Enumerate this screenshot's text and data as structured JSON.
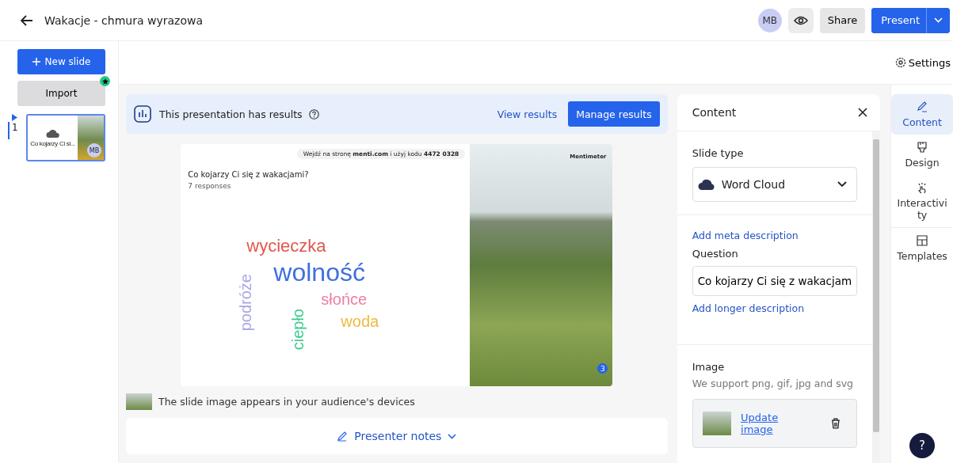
{
  "header": {
    "title": "Wakacje - chmura wyrazowa",
    "avatar": "MB",
    "share": "Share",
    "present": "Present"
  },
  "sidebar": {
    "new_slide": "New slide",
    "import": "Import",
    "slides": [
      {
        "number": "1",
        "caption": "Co kojarzy Ci si...",
        "avatar": "MB",
        "selected": true
      }
    ]
  },
  "toolbar": {
    "settings": "Settings"
  },
  "results_banner": {
    "text": "This presentation has results",
    "view": "View results",
    "manage": "Manage results"
  },
  "slide": {
    "join_prefix": "Wejdź na stronę",
    "join_site": "menti.com",
    "join_mid": "i użyj kodu",
    "join_code": "4472 0328",
    "brand": "Mentimeter",
    "question": "Co kojarzy Ci się z wakacjami?",
    "responses": "7 responses",
    "corner_badge": "3",
    "words": [
      {
        "text": "wycieczka",
        "color": "#e2564c",
        "vertical": false
      },
      {
        "text": "wolność",
        "color": "#3f6fe0",
        "vertical": false
      },
      {
        "text": "słońce",
        "color": "#ea80a4",
        "vertical": false
      },
      {
        "text": "woda",
        "color": "#f0b83e",
        "vertical": false
      },
      {
        "text": "podróże",
        "color": "#a8a6e6",
        "vertical": true
      },
      {
        "text": "ciepło",
        "color": "#3ecb8c",
        "vertical": true
      }
    ]
  },
  "image_note": "The slide image appears in your audience's devices",
  "presenter_notes": "Presenter notes",
  "content_panel": {
    "title": "Content",
    "slide_type_label": "Slide type",
    "slide_type": "Word Cloud",
    "meta_link": "Add meta description",
    "question_label": "Question",
    "question_value": "Co kojarzy Ci się z wakacjam",
    "longer_link": "Add longer description",
    "image_label": "Image",
    "image_hint": "We support png, gif, jpg and svg",
    "update_image": "Update image"
  },
  "side_tabs": [
    {
      "label": "Content",
      "selected": true
    },
    {
      "label": "Design",
      "selected": false
    },
    {
      "label": "Interactivity",
      "selected": false
    },
    {
      "label": "Templates",
      "selected": false
    }
  ],
  "help": "?"
}
